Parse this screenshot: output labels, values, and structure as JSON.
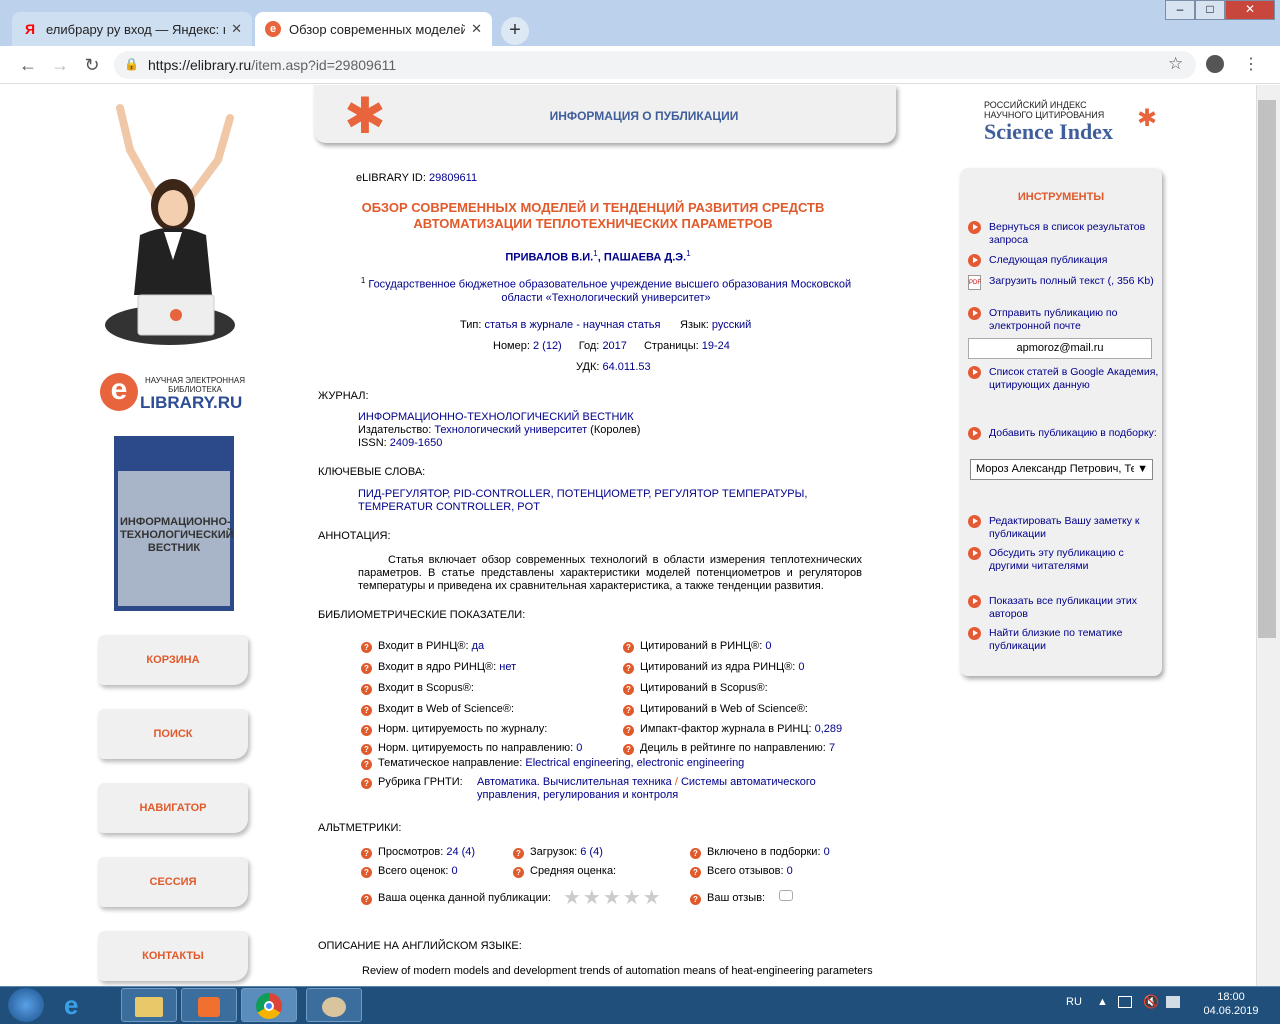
{
  "browser": {
    "tabs": [
      {
        "title": "елибрару ру вход — Яндекс: на",
        "icon": "yandex-icon"
      },
      {
        "title": "Обзор современных моделей и",
        "icon": "elibrary-icon"
      }
    ],
    "url_host": "https://elibrary.ru",
    "url_path": "/item.asp?id=29809611"
  },
  "header": {
    "banner_title": "ИНФОРМАЦИЯ О ПУБЛИКАЦИИ",
    "logo_line1": "НАУЧНАЯ ЭЛЕКТРОННАЯ",
    "logo_line2": "БИБЛИОТЕКА",
    "logo_name": "LIBRARY.RU",
    "logo_e": "e",
    "si_line1": "РОССИЙСКИЙ ИНДЕКС",
    "si_line2": "НАУЧНОГО ЦИТИРОВАНИЯ",
    "si_name": "Science Index"
  },
  "left_menu": [
    "КОРЗИНА",
    "ПОИСК",
    "НАВИГАТОР",
    "СЕССИЯ",
    "КОНТАКТЫ"
  ],
  "cover": {
    "text": "ИНФОРМАЦИОННО-ТЕХНОЛОГИЧЕСКИЙ ВЕСТНИК"
  },
  "pub": {
    "id_label": "eLIBRARY ID:",
    "id": "29809611",
    "title": "ОБЗОР СОВРЕМЕННЫХ МОДЕЛЕЙ И ТЕНДЕНЦИЙ РАЗВИТИЯ СРЕДСТВ АВТОМАТИЗАЦИИ ТЕПЛОТЕХНИЧЕСКИХ ПАРАМЕТРОВ",
    "author1": "ПРИВАЛОВ В.И.",
    "author2": "ПАШАЕВА Д.Э.",
    "sup": "1",
    "sep": ",",
    "affiliation": "Государственное бюджетное образовательное учреждение высшего образования Московской области «Технологический университет»",
    "type_label": "Тип:",
    "type": "статья в журнале - научная статья",
    "lang_label": "Язык:",
    "lang": "русский",
    "issue_label": "Номер:",
    "issue": "2 (12)",
    "year_label": "Год:",
    "year": "2017",
    "pages_label": "Страницы:",
    "pages": "19-24",
    "udk_label": "УДК:",
    "udk": "64.011.53"
  },
  "journal": {
    "section": "ЖУРНАЛ:",
    "name": "ИНФОРМАЦИОННО-ТЕХНОЛОГИЧЕСКИЙ ВЕСТНИК",
    "publisher_label": "Издательство:",
    "publisher": "Технологический университет",
    "publisher_city": "(Королев)",
    "issn_label": "ISSN:",
    "issn": "2409-1650"
  },
  "keywords": {
    "section": "КЛЮЧЕВЫЕ СЛОВА:",
    "text": "ПИД-РЕГУЛЯТОР, PID-CONTROLLER, ПОТЕНЦИОМЕТР, РЕГУЛЯТОР ТЕМПЕРАТУРЫ, TEMPERATUR CONTROLLER, POT"
  },
  "annotation": {
    "section": "АННОТАЦИЯ:",
    "text": "Статья включает обзор современных технологий в области измерения теплотехнических параметров. В статье представлены характеристики моделей потенциометров и регуляторов температуры и приведена их сравнительная характеристика, а также тенденции развития."
  },
  "biblio": {
    "section": "БИБЛИОМЕТРИЧЕСКИЕ ПОКАЗАТЕЛИ:",
    "left": [
      {
        "label": "Входит в РИНЦ®:",
        "value": "да"
      },
      {
        "label": "Входит в ядро РИНЦ®:",
        "value": "нет"
      },
      {
        "label": "Входит в Scopus®:",
        "value": ""
      },
      {
        "label": "Входит в Web of Science®:",
        "value": ""
      },
      {
        "label": "Норм. цитируемость по журналу:",
        "value": ""
      },
      {
        "label": "Норм. цитируемость по направлению:",
        "value": "0"
      }
    ],
    "right": [
      {
        "label": "Цитирований в РИНЦ®:",
        "value": "0"
      },
      {
        "label": "Цитирований из ядра РИНЦ®:",
        "value": "0"
      },
      {
        "label": "Цитирований в Scopus®:",
        "value": ""
      },
      {
        "label": "Цитирований в Web of Science®:",
        "value": ""
      },
      {
        "label": "Импакт-фактор журнала в РИНЦ:",
        "value": "0,289"
      },
      {
        "label": "Дециль в рейтинге по направлению:",
        "value": "7"
      }
    ],
    "theme_label": "Тематическое направление:",
    "theme": "Electrical engineering, electronic engineering",
    "grnti_label": "Рубрика ГРНТИ:",
    "grnti1": "Автоматика. Вычислительная техника",
    "grnti_sep": "/",
    "grnti2": "Системы автоматического управления, регулирования и контроля"
  },
  "alt": {
    "section": "АЛЬТМЕТРИКИ:",
    "views_label": "Просмотров:",
    "views": "24 (4)",
    "downloads_label": "Загрузок:",
    "downloads": "6 (4)",
    "included_label": "Включено в подборки:",
    "included": "0",
    "ratings_label": "Всего оценок:",
    "ratings": "0",
    "avg_label": "Средняя оценка:",
    "reviews_label": "Всего отзывов:",
    "reviews": "0",
    "your_rating_label": "Ваша оценка данной публикации:",
    "stars": "★★★★★",
    "your_review_label": "Ваш отзыв:"
  },
  "english": {
    "section": "ОПИСАНИЕ НА АНГЛИЙСКОМ ЯЗЫКЕ:",
    "title": "Review of modern models and development trends of automation means of heat-engineering parameters"
  },
  "tools": {
    "title": "ИНСТРУМЕНТЫ",
    "items": [
      "Вернуться в список результатов запроса",
      "Следующая публикация",
      "Загрузить полный текст (, 356 Kb)",
      "Отправить публикацию по электронной почте",
      "Список статей в Google Академия, цитирующих данную",
      "Добавить публикацию в подборку:",
      "Редактировать Вашу заметку к публикации",
      "Обсудить эту публикацию с другими читателями",
      "Показать все публикации этих авторов",
      "Найти близкие по тематике публикации"
    ],
    "email": "apmoroz@mail.ru",
    "select": "Мороз Александр Петрович, Тех"
  },
  "taskbar": {
    "lang": "RU",
    "time": "18:00",
    "date": "04.06.2019"
  }
}
